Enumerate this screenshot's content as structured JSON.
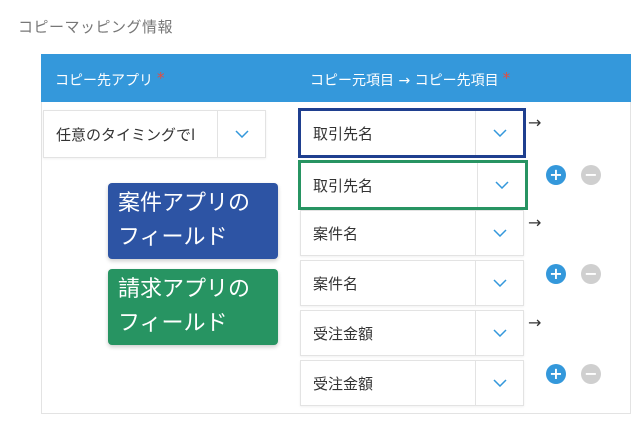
{
  "section_title": "コピーマッピング情報",
  "header": {
    "col_source_app": "コピー先アプリ",
    "col_fields": "コピー元項目 → コピー先項目",
    "required_mark": "*"
  },
  "timing_dropdown": {
    "value": "任意のタイミングでl"
  },
  "mapping_pairs": [
    {
      "source": "取引先名",
      "target": "取引先名"
    },
    {
      "source": "案件名",
      "target": "案件名"
    },
    {
      "source": "受注金額",
      "target": "受注金額"
    }
  ],
  "arrow_glyph": "→",
  "add_glyph": "+",
  "remove_glyph": "−",
  "callouts": {
    "case_app": {
      "line1": "案件アプリの",
      "line2": "フィールド"
    },
    "billing_app": {
      "line1": "請求アプリの",
      "line2": "フィールド"
    }
  },
  "colors": {
    "header_bg": "#3498db",
    "required": "#e74c3c",
    "source_highlight": "#1f3f8f",
    "target_highlight": "#279462",
    "callout_blue": "#2d54a4",
    "callout_green": "#279462"
  }
}
